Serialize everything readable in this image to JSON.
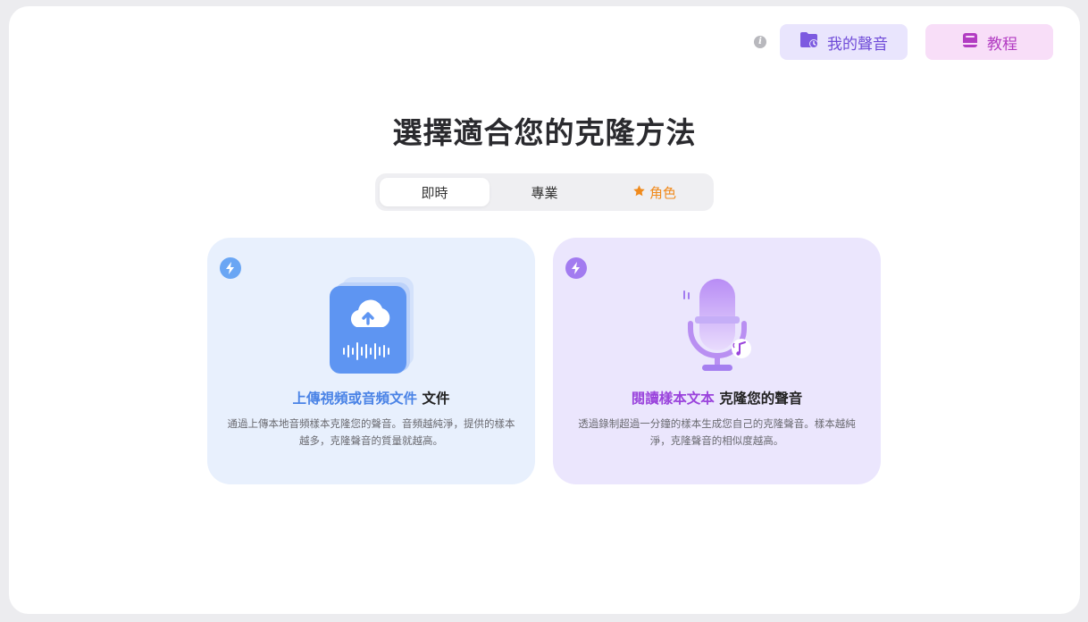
{
  "header": {
    "info_icon": "info-icon",
    "my_voice_label": "我的聲音",
    "tutorial_label": "教程"
  },
  "main": {
    "title": "選擇適合您的克隆方法",
    "tabs": [
      {
        "label": "即時",
        "active": true
      },
      {
        "label": "專業",
        "active": false
      },
      {
        "label": "角色",
        "active": false,
        "icon": "star-icon"
      }
    ],
    "cards": [
      {
        "icon": "lightning-icon",
        "illustration": "cloud-upload-audio-file",
        "title_highlight": "上傳視頻或音頻文件",
        "title_rest": " 文件",
        "description": "通過上傳本地音頻樣本克隆您的聲音。音頻越純淨，提供的樣本越多，克隆聲音的質量就越高。"
      },
      {
        "icon": "lightning-icon",
        "illustration": "microphone",
        "title_highlight": "閱讀樣本文本",
        "title_rest": " 克隆您的聲音",
        "description": "透過錄制超過一分鐘的樣本生成您自己的克隆聲音。樣本越純淨，克隆聲音的相似度越高。"
      }
    ]
  },
  "colors": {
    "upload_accent": "#4a83e6",
    "read_accent": "#9a44dc",
    "role_tab": "#f08a1c"
  }
}
